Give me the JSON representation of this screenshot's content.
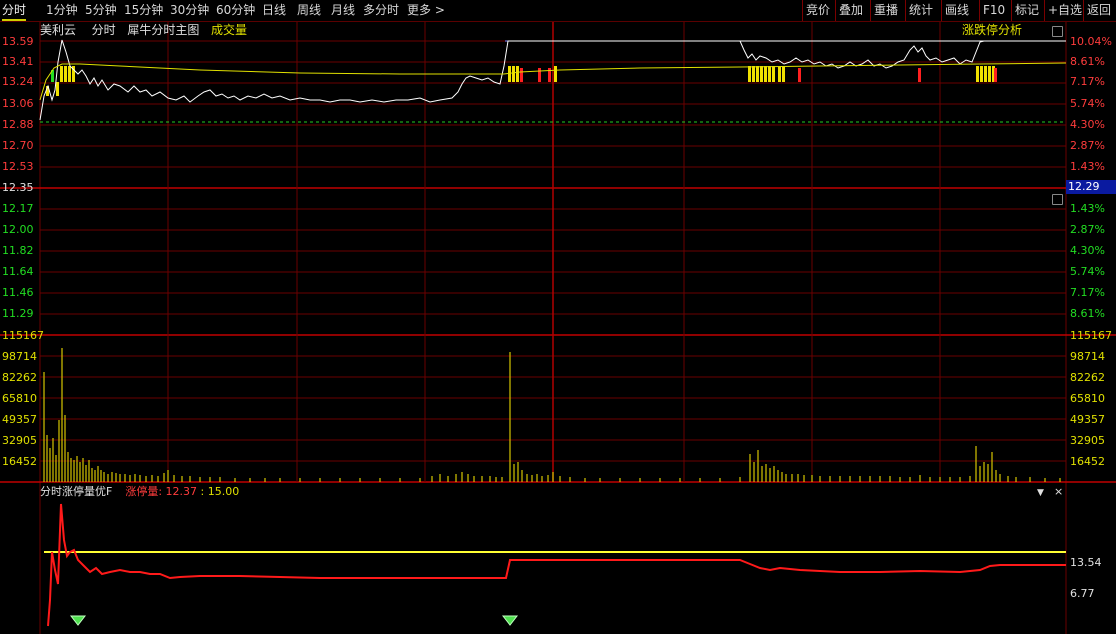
{
  "toolbar": {
    "left_items": [
      "分时",
      "1分钟",
      "5分钟",
      "15分钟",
      "30分钟",
      "60分钟",
      "日线",
      "周线",
      "月线",
      "多分时",
      "更多 >"
    ],
    "right_items": [
      "竞价",
      "叠加",
      "重播",
      "统计",
      "画线",
      "F10",
      "标记",
      "+自选",
      "返回"
    ]
  },
  "chart_header": {
    "stock_name": "美利云",
    "mode": "分时",
    "indicator": "犀牛分时主图",
    "volume_label": "成交量",
    "limit_analysis": "涨跌停分析"
  },
  "price_axis": {
    "up_prices": [
      "13.59",
      "13.41",
      "13.24",
      "13.06",
      "12.88",
      "12.70",
      "12.53"
    ],
    "prev_close": "12.35",
    "down_prices": [
      "12.17",
      "12.00",
      "11.82",
      "11.64",
      "11.46",
      "11.29"
    ],
    "up_pcts": [
      "10.04%",
      "8.61%",
      "7.17%",
      "5.74%",
      "4.30%",
      "2.87%",
      "1.43%"
    ],
    "down_pcts": [
      "1.43%",
      "2.87%",
      "4.30%",
      "5.74%",
      "7.17%",
      "8.61%"
    ],
    "current_price": "12.29"
  },
  "volume_axis": {
    "labels": [
      "115167",
      "98714",
      "82262",
      "65810",
      "49357",
      "32905",
      "16452"
    ]
  },
  "indicator_panel": {
    "name": "分时涨停量优F",
    "series_label": "涨停量",
    "value1": "12.37",
    "value2": "15.00",
    "right_labels": [
      "13.54",
      "6.77"
    ]
  },
  "colors": {
    "grid": "#6a0000",
    "price_line": "#ffffff",
    "avg_line": "#e0e000",
    "indicator_line": "#ff1a1a",
    "threshold_line": "#ffff33",
    "up": "#ff3c3c",
    "down": "#22dd22"
  }
}
